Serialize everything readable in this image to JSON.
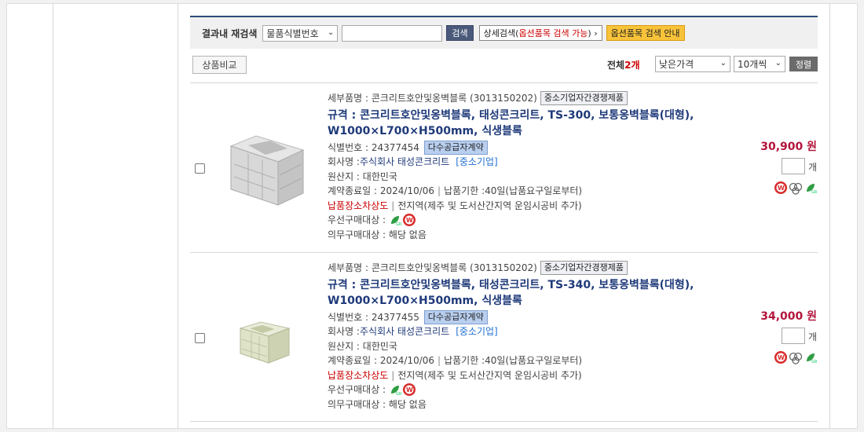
{
  "search": {
    "title": "결과내 재검색",
    "select_value": "물품식별번호",
    "input_value": "",
    "search_button": "검색",
    "detail_button_prefix": "상세검색(",
    "detail_button_red": "옵션품목 검색 가능",
    "detail_button_suffix": ") ›",
    "guide_button": "옵션품목 검색 안내"
  },
  "toolbar": {
    "compare_button": "상품비교",
    "total_label": "전체",
    "total_count": "2개",
    "sort_select": "낮은가격",
    "count_select": "10개씩",
    "sort_button": "정렬"
  },
  "items": [
    {
      "category": "세부품명 : 콘크리트호안및옹벽블록 (3013150202)",
      "category_tag": "중소기업자간경쟁제품",
      "spec": "규격 : 콘크리트호안및옹벽블록, 태성콘크리트, TS-300, 보통옹벽블록(대형), W1000×L700×H500mm, 식생블록",
      "id_label": "식별번호 : 24377454",
      "id_tag": "다수공급자계약",
      "company_label": "회사명 : ",
      "company": "주식회사 태성콘크리트",
      "company_type": "[중소기업]",
      "origin": "원산지 : 대한민국",
      "contract": "계약종료일 : 2024/10/06",
      "delivery": "납품기한 :40일(납품요구일로부터)",
      "region_label": "납품장소차상도",
      "region": "전지역(제주 및 도서산간지역 운임시공비 추가)",
      "priority": "우선구매대상 :",
      "mandatory": "의무구매대상 : 해당 없음",
      "price": "30,900 원",
      "qty_value": "",
      "unit": "개"
    },
    {
      "category": "세부품명 : 콘크리트호안및옹벽블록 (3013150202)",
      "category_tag": "중소기업자간경쟁제품",
      "spec": "규격 : 콘크리트호안및옹벽블록, 태성콘크리트, TS-340, 보통옹벽블록(대형), W1000×L700×H500mm, 식생블록",
      "id_label": "식별번호 : 24377455",
      "id_tag": "다수공급자계약",
      "company_label": "회사명 : ",
      "company": "주식회사 태성콘크리트",
      "company_type": "[중소기업]",
      "origin": "원산지 : 대한민국",
      "contract": "계약종료일 : 2024/10/06",
      "delivery": "납품기한 :40일(납품요구일로부터)",
      "region_label": "납품장소차상도",
      "region": "전지역(제주 및 도서산간지역 운임시공비 추가)",
      "priority": "우선구매대상 :",
      "mandatory": "의무구매대상 : 해당 없음",
      "price": "34,000 원",
      "qty_value": "",
      "unit": "개"
    }
  ],
  "colors": {
    "accent_navy": "#2f4a7a",
    "price_red": "#b3143c",
    "spec_blue": "#1f3a7a",
    "guide_yellow": "#f8c33a"
  },
  "icons": [
    "green-product-icon",
    "excellence-w-icon",
    "certification-icon"
  ]
}
